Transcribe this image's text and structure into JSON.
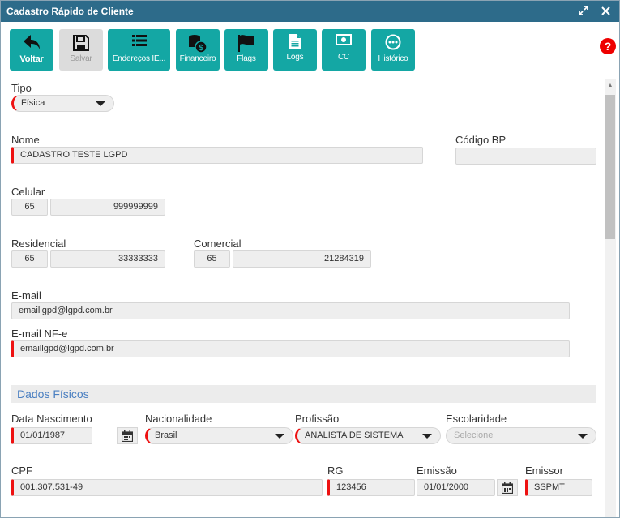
{
  "window": {
    "title": "Cadastro Rápido de Cliente",
    "expand_icon": "expand-icon",
    "close_icon": "close-icon"
  },
  "toolbar": {
    "buttons": [
      {
        "label": "Voltar",
        "icon": "back-arrow-icon",
        "enabled": true
      },
      {
        "label": "Salvar",
        "icon": "floppy-disk-icon",
        "enabled": false
      },
      {
        "label": "Endereços IE...",
        "icon": "list-icon",
        "enabled": true
      },
      {
        "label": "Financeiro",
        "icon": "coins-icon",
        "enabled": true
      },
      {
        "label": "Flags",
        "icon": "flag-icon",
        "enabled": true
      },
      {
        "label": "Logs",
        "icon": "document-icon",
        "enabled": true
      },
      {
        "label": "CC",
        "icon": "money-icon",
        "enabled": true
      },
      {
        "label": "Histórico",
        "icon": "ellipsis-circle-icon",
        "enabled": true
      }
    ],
    "help_icon": "?"
  },
  "form": {
    "tipo": {
      "label": "Tipo",
      "value": "Física"
    },
    "nome": {
      "label": "Nome",
      "value": "CADASTRO TESTE LGPD"
    },
    "codigo_bp": {
      "label": "Código BP",
      "value": ""
    },
    "celular": {
      "label": "Celular",
      "ddd": "65",
      "number": "999999999"
    },
    "residencial": {
      "label": "Residencial",
      "ddd": "65",
      "number": "33333333"
    },
    "comercial": {
      "label": "Comercial",
      "ddd": "65",
      "number": "21284319"
    },
    "email": {
      "label": "E-mail",
      "value": "emaillgpd@lgpd.com.br"
    },
    "email_nfe": {
      "label": "E-mail NF-e",
      "value": "emaillgpd@lgpd.com.br"
    }
  },
  "dados_fisicos": {
    "title": "Dados Físicos",
    "data_nascimento": {
      "label": "Data Nascimento",
      "value": "01/01/1987"
    },
    "nacionalidade": {
      "label": "Nacionalidade",
      "value": "Brasil"
    },
    "profissao": {
      "label": "Profissão",
      "value": "ANALISTA DE SISTEMA"
    },
    "escolaridade": {
      "label": "Escolaridade",
      "placeholder": "Selecione"
    },
    "cpf": {
      "label": "CPF",
      "value": "001.307.531-49"
    },
    "rg": {
      "label": "RG",
      "value": "123456"
    },
    "emissao": {
      "label": "Emissão",
      "value": "01/01/2000"
    },
    "emissor": {
      "label": "Emissor",
      "value": "SSPMT"
    }
  },
  "colors": {
    "titlebar": "#2d6b8a",
    "button": "#14a7a4",
    "required": "#ee1111",
    "section_title": "#4a7fc1"
  }
}
